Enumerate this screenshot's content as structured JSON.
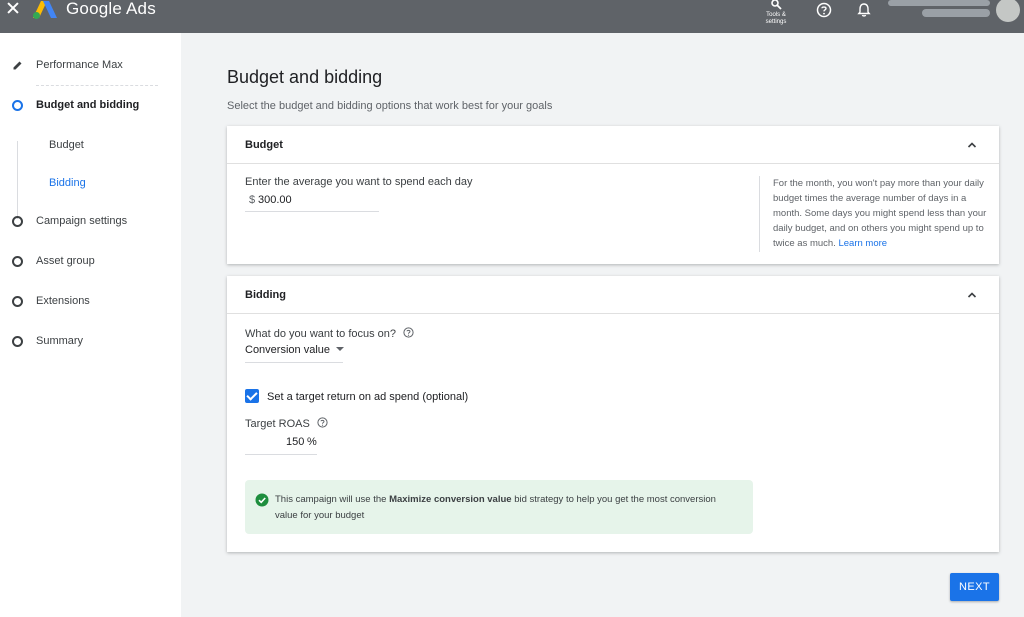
{
  "app": {
    "brand": "Google Ads",
    "tools_label": "Tools & settings"
  },
  "sidebar": {
    "steps": [
      {
        "label": "Performance Max"
      },
      {
        "label": "Budget and bidding"
      },
      {
        "label": "Campaign settings"
      },
      {
        "label": "Asset group"
      },
      {
        "label": "Extensions"
      },
      {
        "label": "Summary"
      }
    ],
    "substeps": [
      {
        "label": "Budget"
      },
      {
        "label": "Bidding"
      }
    ]
  },
  "main": {
    "title": "Budget and bidding",
    "subtitle": "Select the budget and bidding options that work best for your goals",
    "budget": {
      "title": "Budget",
      "field_label": "Enter the average you want to spend each day",
      "currency": "$",
      "amount": "300.00",
      "info": "For the month, you won't pay more than your daily budget times the average number of days in a month. Some days you might spend less than your daily budget, and on others you might spend up to twice as much.",
      "learn_more": "Learn more"
    },
    "bidding": {
      "title": "Bidding",
      "focus_label": "What do you want to focus on?",
      "focus_value": "Conversion value",
      "checkbox_label": "Set a target return on ad spend (optional)",
      "checkbox_checked": true,
      "roas_label": "Target ROAS",
      "roas_value": "150",
      "roas_unit": "%",
      "notice_pre": "This campaign will use the ",
      "notice_bold": "Maximize conversion value",
      "notice_post": " bid strategy to help you get the most conversion value for your budget"
    },
    "next_label": "NEXT"
  },
  "colors": {
    "accent": "#1a73e8",
    "topbar": "#5f6368",
    "success_bg": "#e6f4ea",
    "success_icon": "#1e8e3e"
  }
}
